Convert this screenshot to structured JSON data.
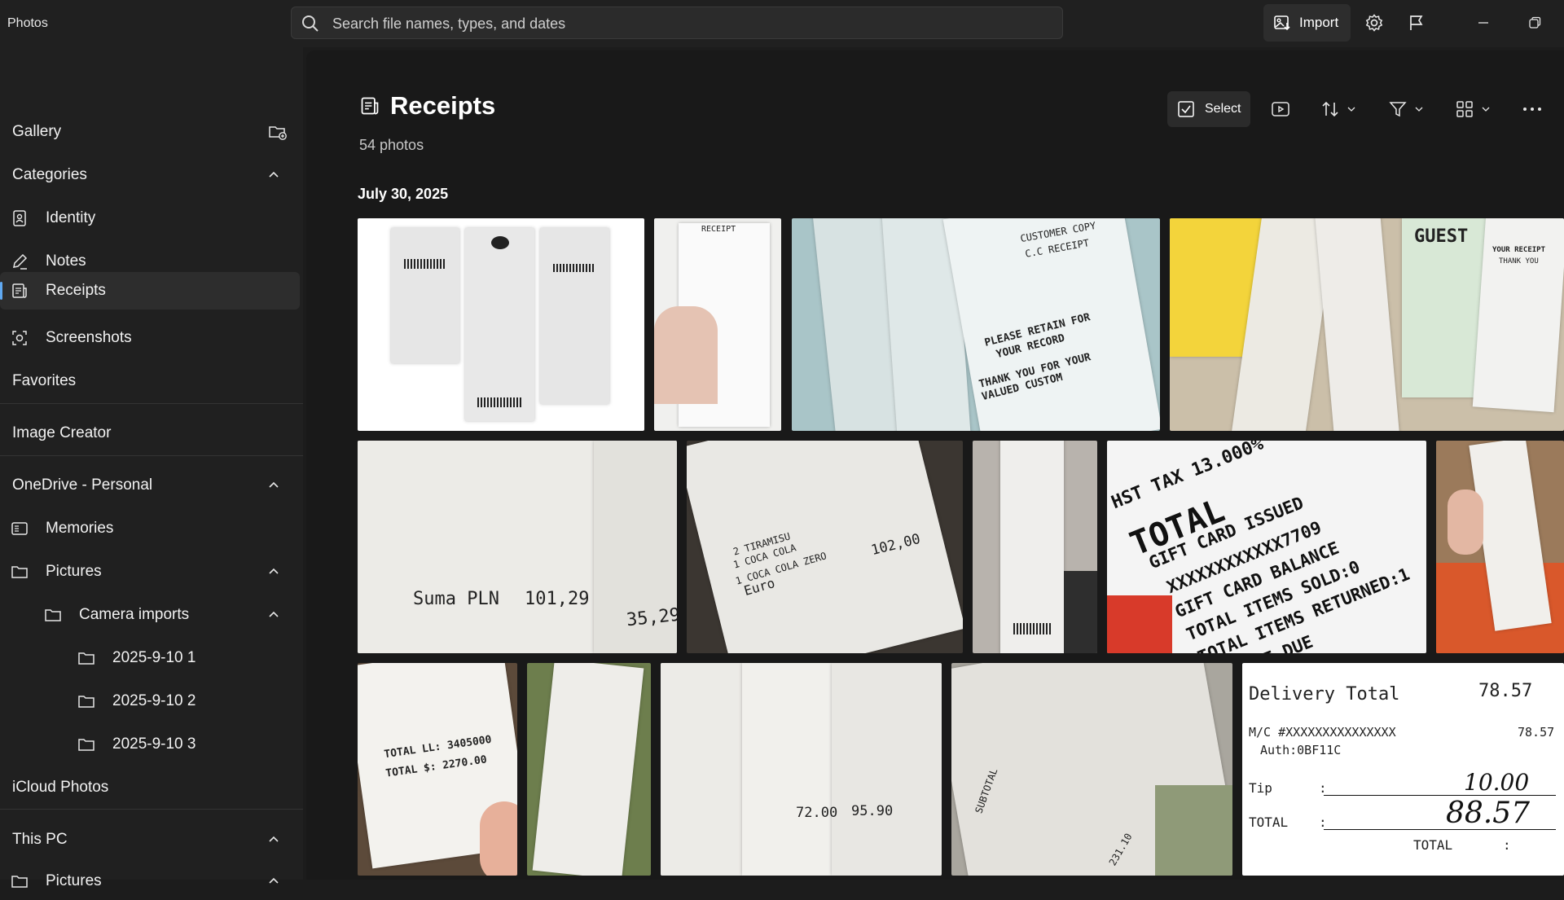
{
  "app": {
    "name": "Photos"
  },
  "search": {
    "placeholder": "Search file names, types, and dates"
  },
  "titlebar": {
    "import_label": "Import"
  },
  "sidebar": {
    "gallery": "Gallery",
    "categories": "Categories",
    "category_items": [
      "Identity",
      "Notes",
      "Receipts",
      "Screenshots"
    ],
    "favorites": "Favorites",
    "image_creator": "Image Creator",
    "onedrive": "OneDrive - Personal",
    "memories": "Memories",
    "pictures": "Pictures",
    "camera_imports": "Camera imports",
    "folders": [
      "2025-9-10 1",
      "2025-9-10 2",
      "2025-9-10 3"
    ],
    "icloud": "iCloud Photos",
    "this_pc": "This PC",
    "this_pc_pictures": "Pictures"
  },
  "main": {
    "title": "Receipts",
    "count": "54 photos",
    "select_label": "Select",
    "date_group": "July 30, 2025"
  },
  "receipt_text": {
    "r1_small": "RECEIPT",
    "r2_cc": "C.C RECEIPT",
    "r2_cust": "CUSTOMER COPY",
    "r2_retain": "PLEASE RETAIN FOR",
    "r2_record": "YOUR RECORD",
    "r2_thank": "THANK YOU FOR YOUR",
    "r2_valued": "VALUED CUSTOM",
    "r3_guest": "GUEST",
    "r3_your": "YOUR RECEIPT",
    "r3_thank": "THANK YOU",
    "suma": "Suma PLN",
    "suma_val": "101,29",
    "val_3529": "35,29",
    "euro": "Euro",
    "val_102": "102,00",
    "coca1": "1 COCA COLA",
    "coca2": "1 COCA COLA ZERO",
    "tiramisu": "2 TIRAMISU",
    "hst": "HST TAX 13.000%",
    "total": "TOTAL",
    "gift_issued": "GIFT CARD ISSUED",
    "gift_x": "XXXXXXXXXXXX7709",
    "gift_balance": "GIFT CARD BALANCE",
    "items_sold": "TOTAL ITEMS SOLD:0",
    "items_returned": "TOTAL ITEMS RETURNED:1",
    "change": "CHANGE DUE",
    "total_ll": "TOTAL LL: 3405000",
    "total_s": "TOTAL $: 2270.00",
    "val_7200": "72.00",
    "val_9590": "95.90",
    "subtotal": "SUBTOTAL",
    "val_23110": "231.10",
    "delivery": "Delivery Total",
    "delivery_val": "78.57",
    "mc": "M/C #XXXXXXXXXXXXXXX",
    "mc_val": "78.57",
    "auth": "Auth:0BF11C",
    "tip": "Tip",
    "tip_val": "10.00",
    "total_lbl": "TOTAL",
    "total_val": "88.57",
    "total_colon": "TOTAL"
  }
}
